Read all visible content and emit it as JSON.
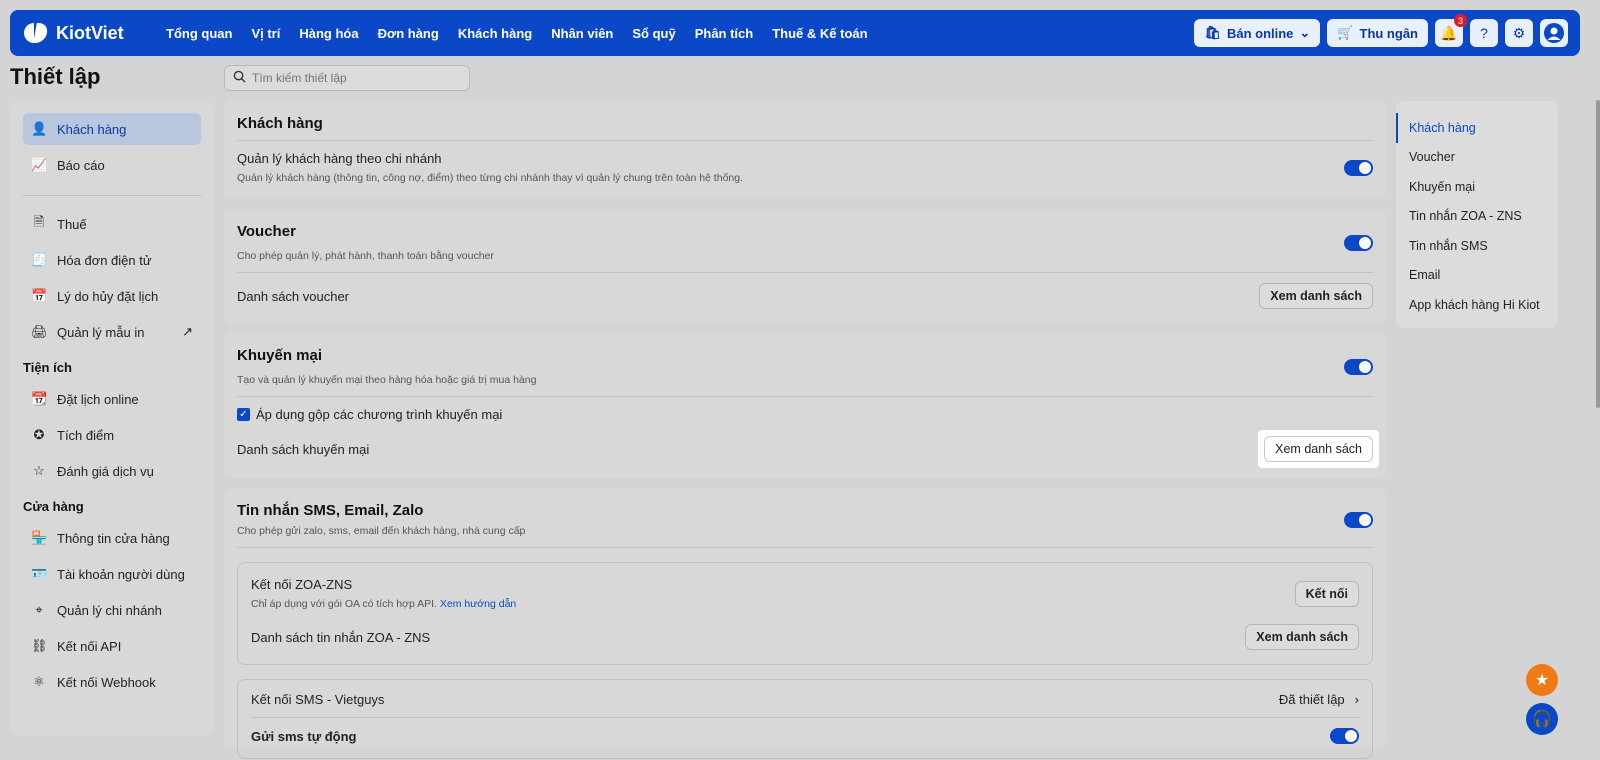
{
  "brand": {
    "name": "KiotViet"
  },
  "nav": [
    "Tổng quan",
    "Vị trí",
    "Hàng hóa",
    "Đơn hàng",
    "Khách hàng",
    "Nhân viên",
    "Sổ quỹ",
    "Phân tích",
    "Thuế & Kế toán"
  ],
  "top_actions": {
    "online_label": "Bán online",
    "cashier_label": "Thu ngân",
    "notification_count": "3"
  },
  "page_title": "Thiết lập",
  "search": {
    "placeholder": "Tìm kiếm thiết lập"
  },
  "sidebar": {
    "items_top": [
      {
        "label": "Khách hàng",
        "icon": "user-icon"
      },
      {
        "label": "Báo cáo",
        "icon": "chart-icon"
      }
    ],
    "items_mid": [
      {
        "label": "Thuế",
        "icon": "vat-icon"
      },
      {
        "label": "Hóa đơn điện tử",
        "icon": "invoice-icon"
      },
      {
        "label": "Lý do hủy đặt lịch",
        "icon": "calendar-cancel-icon"
      },
      {
        "label": "Quản lý mẫu in",
        "icon": "printer-icon"
      }
    ],
    "group_utilities": "Tiện ích",
    "items_utilities": [
      {
        "label": "Đặt lịch online",
        "icon": "calendar-icon"
      },
      {
        "label": "Tích điểm",
        "icon": "star-circle-icon"
      },
      {
        "label": "Đánh giá dịch vụ",
        "icon": "star-icon"
      }
    ],
    "group_store": "Cửa hàng",
    "items_store": [
      {
        "label": "Thông tin cửa hàng",
        "icon": "store-icon"
      },
      {
        "label": "Tài khoản người dùng",
        "icon": "account-icon"
      },
      {
        "label": "Quản lý chi nhánh",
        "icon": "location-icon"
      },
      {
        "label": "Kết nối API",
        "icon": "link-icon"
      },
      {
        "label": "Kết nối Webhook",
        "icon": "webhook-icon"
      }
    ]
  },
  "sections": {
    "customers": {
      "title": "Khách hàng",
      "setting_title": "Quản lý khách hàng theo chi nhánh",
      "setting_desc": "Quản lý khách hàng (thông tin, công nợ, điểm) theo từng chi nhánh thay vì quản lý chung trên toàn hệ thống."
    },
    "voucher": {
      "title": "Voucher",
      "desc": "Cho phép quản lý, phát hành, thanh toán bằng voucher",
      "list_label": "Danh sách voucher",
      "list_button": "Xem danh sách"
    },
    "promotion": {
      "title": "Khuyến mại",
      "desc": "Tạo và quản lý khuyến mại theo hàng hóa hoặc giá trị mua hàng",
      "checkbox_label": "Áp dụng gộp các chương trình khuyến mại",
      "list_label": "Danh sách khuyến mại",
      "list_button": "Xem danh sách"
    },
    "messaging": {
      "title": "Tin nhắn SMS, Email, Zalo",
      "desc": "Cho phép gửi zalo, sms, email đến khách hàng, nhà cung cấp",
      "zoa": {
        "title": "Kết nối ZOA-ZNS",
        "desc": "Chỉ áp dụng với gói OA có tích hợp API.",
        "link": "Xem hướng dẫn",
        "connect_button": "Kết nối",
        "list_label": "Danh sách tin nhắn ZOA - ZNS",
        "list_button": "Xem danh sách"
      },
      "sms": {
        "title": "Kết nối SMS - Vietguys",
        "status": "Đã thiết lập",
        "auto_label": "Gửi sms tự động"
      }
    }
  },
  "toc": [
    "Khách hàng",
    "Voucher",
    "Khuyến mại",
    "Tin nhắn ZOA - ZNS",
    "Tin nhắn SMS",
    "Email",
    "App khách hàng Hi Kiot"
  ],
  "colors": {
    "primary": "#0a48c8",
    "fab_orange": "#f07a14"
  }
}
